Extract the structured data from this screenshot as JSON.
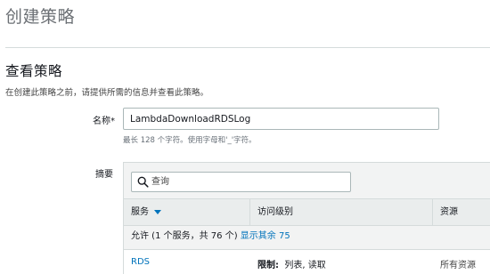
{
  "page": {
    "title": "创建策略"
  },
  "review": {
    "heading": "查看策略",
    "description": "在创建此策略之前，请提供所需的信息并查看此策略。"
  },
  "name_field": {
    "label": "名称*",
    "value": "LambdaDownloadRDSLog",
    "hint": "最长 128 个字符。使用字母和'_'字符。"
  },
  "summary": {
    "label": "摘要",
    "search_placeholder": "查询",
    "columns": {
      "service": "服务",
      "access_level": "访问级别",
      "resource": "资源"
    },
    "allow_text": "允许 (1 个服务，共 76 个)",
    "show_remaining_link": "显示其余 75",
    "rows": [
      {
        "service": "RDS",
        "access_prefix": "限制:",
        "access_detail": "列表, 读取",
        "resource": "所有资源"
      }
    ]
  },
  "colors": {
    "link": "#0073bb",
    "title_gray": "#6b6f74",
    "divider": "#d5dbdb"
  }
}
